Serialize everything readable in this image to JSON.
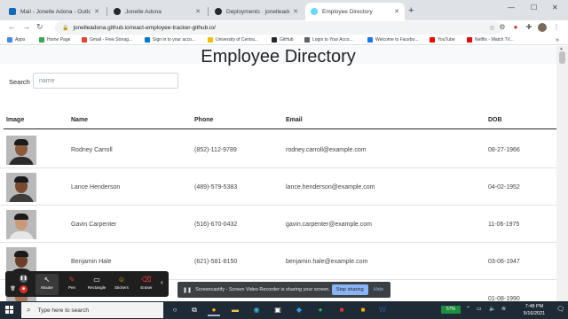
{
  "browser": {
    "tabs": [
      {
        "title": "Mail - Jonelle Adona - Outlook",
        "color": "#0f6cbd",
        "active": false
      },
      {
        "title": "Jonelle Adona",
        "color": "#24292f",
        "active": false
      },
      {
        "title": "Deployments · jonelleadona/re...",
        "color": "#24292f",
        "active": false
      },
      {
        "title": "Employee Directory",
        "color": "#61dafb",
        "active": true
      }
    ],
    "new_tab_glyph": "+",
    "url": "jonelleadona.github.io/react-employee-tracker-github.io/",
    "bookmarks": [
      {
        "label": "Apps",
        "color": "#4285f4"
      },
      {
        "label": "Home Page",
        "color": "#34a853"
      },
      {
        "label": "Gmail - Free Storag...",
        "color": "#ea4335"
      },
      {
        "label": "Sign in to your acco...",
        "color": "#0078d4"
      },
      {
        "label": "University of Centra...",
        "color": "#fbbc04"
      },
      {
        "label": "GitHub",
        "color": "#24292f"
      },
      {
        "label": "Login to Your Acco...",
        "color": "#5f6368"
      },
      {
        "label": "Welcome to Facebo...",
        "color": "#1877f2"
      },
      {
        "label": "YouTube",
        "color": "#ff0000"
      },
      {
        "label": "Netflix - Watch TV...",
        "color": "#e50914"
      }
    ],
    "bookmarks_more": "»"
  },
  "page": {
    "title": "Employee Directory",
    "search_label": "Search",
    "search_placeholder": "name",
    "columns": [
      "Image",
      "Name",
      "Phone",
      "Email",
      "DOB"
    ],
    "employees": [
      {
        "name": "Rodney Carroll",
        "phone": "(852)-112-9789",
        "email": "rodney.carroll@example.com",
        "dob": "08-27-1966",
        "skin": "#8a5a3c",
        "shirt": "#2b2b2b"
      },
      {
        "name": "Lance Henderson",
        "phone": "(489)-579-5383",
        "email": "lance.henderson@example.com",
        "dob": "04-02-1952",
        "skin": "#7a4b30",
        "shirt": "#3d3d3d"
      },
      {
        "name": "Gavin Carpenter",
        "phone": "(516)-670-0432",
        "email": "gavin.carpenter@example.com",
        "dob": "11-06-1975",
        "skin": "#c99a7a",
        "shirt": "#e6e6e6"
      },
      {
        "name": "Benjamin Hale",
        "phone": "(621)-581-8150",
        "email": "benjamin.hale@example.com",
        "dob": "03-06-1947",
        "skin": "#6b3f27",
        "shirt": "#1c1c1c"
      },
      {
        "name": "",
        "phone": "",
        "email": "",
        "dob": "01-08-1990",
        "skin": "#a87452",
        "shirt": "#555555"
      }
    ]
  },
  "recorder": {
    "tools": [
      {
        "label": "Mouse",
        "icon": "cursor-icon",
        "glyph": "↖",
        "active": true
      },
      {
        "label": "Pen",
        "icon": "pen-icon",
        "glyph": "✎",
        "active": false
      },
      {
        "label": "Rectangle",
        "icon": "rectangle-icon",
        "glyph": "▭",
        "active": false
      },
      {
        "label": "Stickers",
        "icon": "sticker-icon",
        "glyph": "☺",
        "active": false
      },
      {
        "label": "Eraser",
        "icon": "eraser-icon",
        "glyph": "⌫",
        "active": false
      }
    ],
    "collapse_glyph": "‹"
  },
  "share_bar": {
    "message": "Screencastify - Screen Video Recorder is sharing your screen.",
    "stop_label": "Stop sharing",
    "hide_label": "Hide"
  },
  "taskbar": {
    "search_placeholder": "Type here to search",
    "battery": "57%",
    "time": "7:48 PM",
    "date": "5/16/2021",
    "accent": "#1f2a37"
  }
}
